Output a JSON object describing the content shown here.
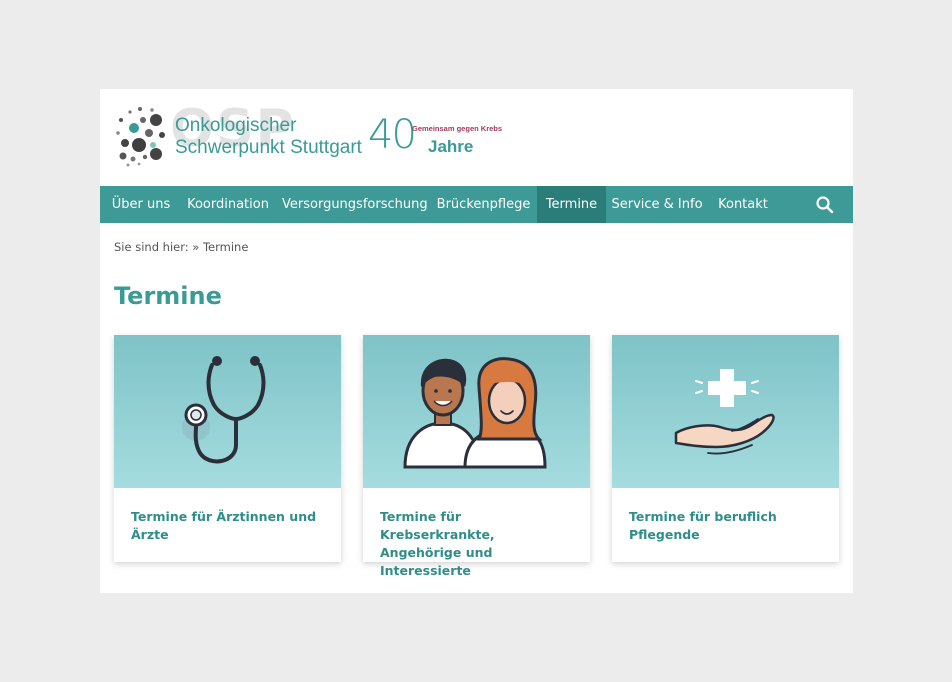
{
  "header": {
    "logo_watermark": "OSP",
    "logo_line1": "Onkologischer",
    "logo_line2": "Schwerpunkt Stuttgart",
    "anniversary_number": "40",
    "anniversary_tagline": "Gemeinsam gegen Krebs",
    "anniversary_word": "Jahre"
  },
  "nav": {
    "items": [
      {
        "label": "Über uns"
      },
      {
        "label": "Koordination"
      },
      {
        "label": "Versorgungsforschung"
      },
      {
        "label": "Brückenpflege"
      },
      {
        "label": "Termine",
        "active": true
      },
      {
        "label": "Service & Info"
      },
      {
        "label": "Kontakt"
      }
    ],
    "search_icon": "search-icon"
  },
  "breadcrumb": {
    "text": "Sie sind hier: » Termine"
  },
  "page_title": "Termine",
  "cards": [
    {
      "label": "Termine für Ärztinnen und Ärzte",
      "icon": "stethoscope-icon"
    },
    {
      "label": "Termine für Krebserkrankte, Angehörige und Interessierte",
      "icon": "people-icon"
    },
    {
      "label": "Termine für beruflich Pflegende",
      "icon": "caring-hand-icon"
    }
  ],
  "colors": {
    "teal": "#3d9a97",
    "teal_active": "#2b7d7a",
    "accent_red": "#a33a5c",
    "card_bg_top": "#7ec3c7",
    "card_bg_bottom": "#a5dcdf"
  }
}
